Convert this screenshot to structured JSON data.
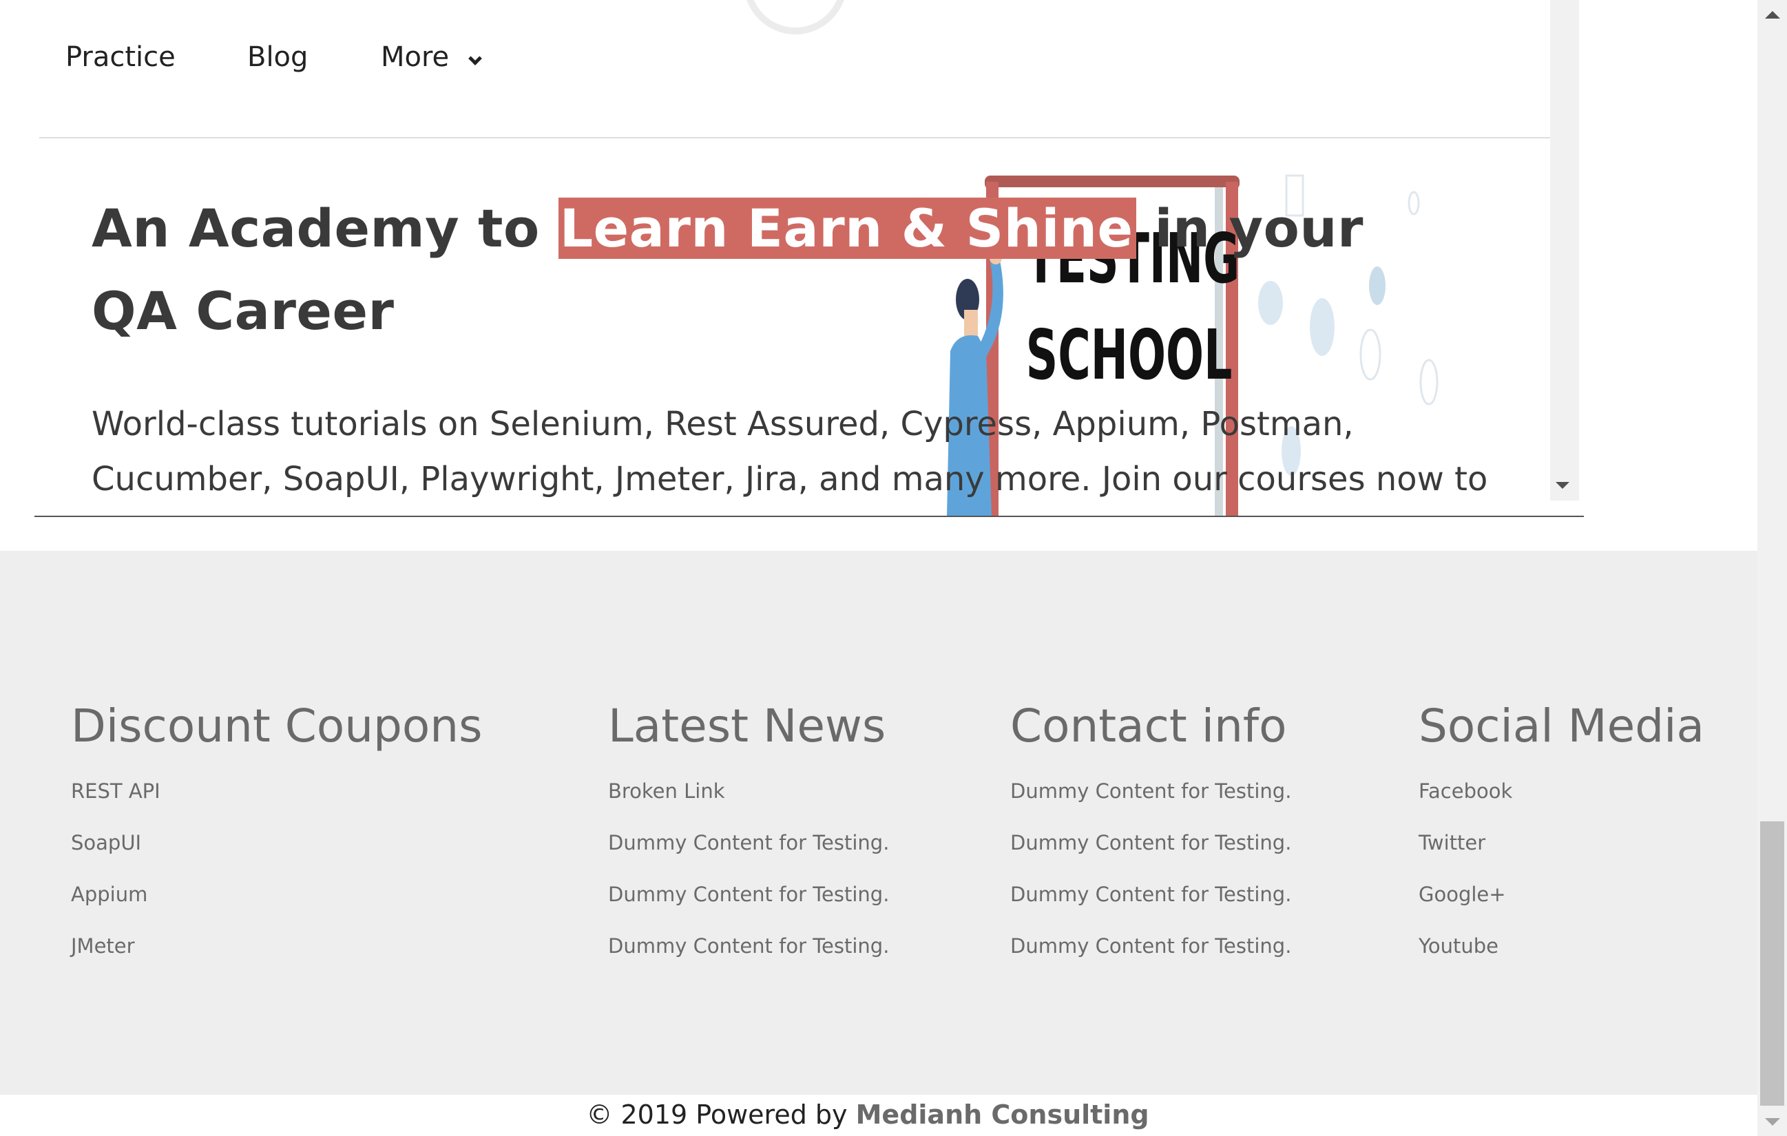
{
  "nav": {
    "items": [
      {
        "label": "Practice"
      },
      {
        "label": "Blog"
      },
      {
        "label": "More"
      }
    ]
  },
  "hero": {
    "headline_before": "An Academy to ",
    "headline_highlight": "Learn Earn & Shine",
    "headline_after": "  in your QA Career",
    "subtitle": "World-class tutorials on Selenium, Rest Assured, Cypress, Appium, Postman, Cucumber, SoapUI, Playwright, Jmeter, Jira, and many more. Join our courses now to get the best job",
    "illustration": {
      "board_line1": "TESTING",
      "board_line2": "SCHOOL"
    }
  },
  "footer": {
    "columns": [
      {
        "title": "Discount Coupons",
        "links": [
          "REST API",
          "SoapUI",
          "Appium",
          "JMeter"
        ]
      },
      {
        "title": "Latest News",
        "links": [
          "Broken Link",
          "Dummy Content for Testing.",
          "Dummy Content for Testing.",
          "Dummy Content for Testing."
        ]
      },
      {
        "title": "Contact info",
        "links": [
          "Dummy Content for Testing.",
          "Dummy Content for Testing.",
          "Dummy Content for Testing.",
          "Dummy Content for Testing."
        ]
      },
      {
        "title": "Social Media",
        "links": [
          "Facebook",
          "Twitter",
          "Google+",
          "Youtube"
        ]
      }
    ],
    "copyright_prefix": "© 2019 Powered by ",
    "copyright_brand": "Medianh Consulting"
  },
  "colors": {
    "highlight": "#cf6a63",
    "text_dark": "#3a3a3a",
    "footer_bg": "#eeeeee",
    "footer_text": "#6a6a6a"
  },
  "icons": {
    "nav_more": "chevron-down-icon"
  }
}
